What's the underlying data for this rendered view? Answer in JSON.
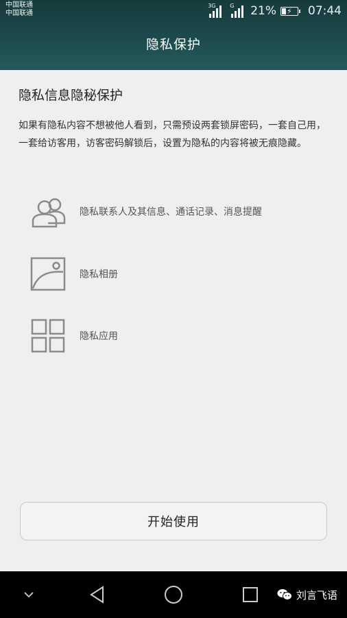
{
  "status_bar": {
    "carrier1": "中国联通",
    "carrier2": "中国联通",
    "signal1_tag": "3G",
    "signal2_tag": "G",
    "battery": "21%",
    "time": "07:44"
  },
  "header": {
    "title": "隐私保护"
  },
  "content": {
    "section_title": "隐私信息隐秘保护",
    "description": "如果有隐私内容不想被他人看到，只需预设两套锁屏密码，一套自己用，一套给访客用，访客密码解锁后，设置为隐私的内容将被无痕隐藏。",
    "features": [
      {
        "icon": "contacts-icon",
        "label": "隐私联系人及其信息、通话记录、消息提醒"
      },
      {
        "icon": "gallery-icon",
        "label": "隐私相册"
      },
      {
        "icon": "apps-grid-icon",
        "label": "隐私应用"
      }
    ]
  },
  "actions": {
    "start_label": "开始使用"
  },
  "watermark": {
    "text": "刘言飞语"
  },
  "colors": {
    "header_bg": "#1d4b4d",
    "page_bg": "#efefef",
    "icon_gray": "#8a8a8a",
    "navbar_bg": "#000000"
  }
}
